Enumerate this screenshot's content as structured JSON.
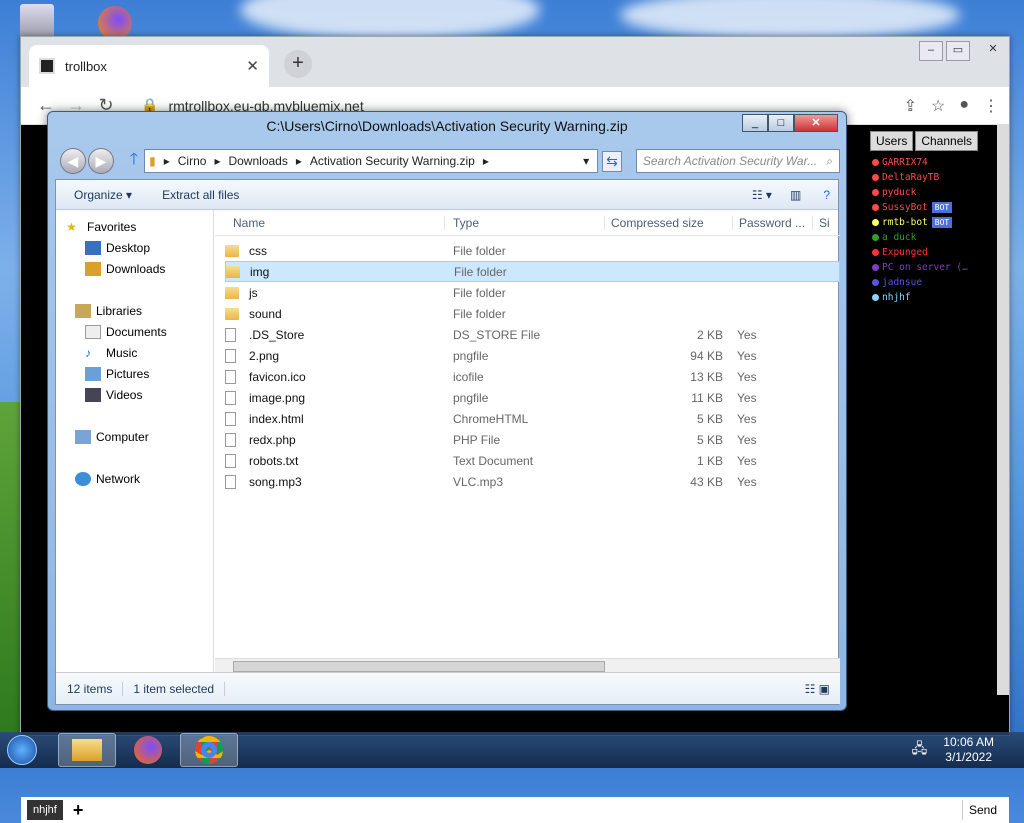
{
  "chrome": {
    "tab_title": "trollbox",
    "url": "rmtrollbox.eu-gb.mybluemix.net",
    "send_label": "Send",
    "input_value": "nhjhf",
    "plus_label": "+"
  },
  "trollbox": {
    "tabs": [
      "Users",
      "Channels"
    ],
    "users": [
      {
        "name": "GARRIX74",
        "color": "#ff4a4a"
      },
      {
        "name": "DeltaRayTB",
        "color": "#ff4a4a"
      },
      {
        "name": "pyduck",
        "color": "#ff4a4a"
      },
      {
        "name": "SussyBot",
        "color": "#ff4a4a",
        "bot": "BOT"
      },
      {
        "name": "rmtb-bot",
        "color": "#ffff66",
        "bot": "BOT"
      },
      {
        "name": "a duck",
        "color": "#2e9f2e"
      },
      {
        "name": "Expunged",
        "color": "#ff3333"
      },
      {
        "name": "PC on server (…",
        "color": "#7c3fbf"
      },
      {
        "name": "jadnsue",
        "color": "#5555dd"
      },
      {
        "name": "nhjhf",
        "color": "#8fd4ff"
      }
    ]
  },
  "explorer": {
    "title": "C:\\Users\\Cirno\\Downloads\\Activation Security Warning.zip",
    "breadcrumb": [
      "Cirno",
      "Downloads",
      "Activation Security Warning.zip"
    ],
    "search_placeholder": "Search Activation Security War...",
    "toolbar": {
      "organize": "Organize ▾",
      "extract": "Extract all files"
    },
    "nav": {
      "favorites": "Favorites",
      "desktop": "Desktop",
      "downloads": "Downloads",
      "libraries": "Libraries",
      "documents": "Documents",
      "music": "Music",
      "pictures": "Pictures",
      "videos": "Videos",
      "computer": "Computer",
      "network": "Network"
    },
    "columns": {
      "name": "Name",
      "type": "Type",
      "compressed": "Compressed size",
      "password": "Password ...",
      "size": "Si"
    },
    "files": [
      {
        "name": "css",
        "type": "File folder",
        "size": "",
        "pw": "",
        "kind": "folder"
      },
      {
        "name": "img",
        "type": "File folder",
        "size": "",
        "pw": "",
        "kind": "folder"
      },
      {
        "name": "js",
        "type": "File folder",
        "size": "",
        "pw": "",
        "kind": "folder"
      },
      {
        "name": "sound",
        "type": "File folder",
        "size": "",
        "pw": "",
        "kind": "folder"
      },
      {
        "name": ".DS_Store",
        "type": "DS_STORE File",
        "size": "2 KB",
        "pw": "Yes",
        "kind": "file"
      },
      {
        "name": "2.png",
        "type": "pngfile",
        "size": "94 KB",
        "pw": "Yes",
        "kind": "file"
      },
      {
        "name": "favicon.ico",
        "type": "icofile",
        "size": "13 KB",
        "pw": "Yes",
        "kind": "file"
      },
      {
        "name": "image.png",
        "type": "pngfile",
        "size": "11 KB",
        "pw": "Yes",
        "kind": "file"
      },
      {
        "name": "index.html",
        "type": "ChromeHTML",
        "size": "5 KB",
        "pw": "Yes",
        "kind": "file"
      },
      {
        "name": "redx.php",
        "type": "PHP File",
        "size": "5 KB",
        "pw": "Yes",
        "kind": "file"
      },
      {
        "name": "robots.txt",
        "type": "Text Document",
        "size": "1 KB",
        "pw": "Yes",
        "kind": "file"
      },
      {
        "name": "song.mp3",
        "type": "VLC.mp3",
        "size": "43 KB",
        "pw": "Yes",
        "kind": "file"
      }
    ],
    "selected_index": 1,
    "status": {
      "count": "12 items",
      "selected": "1 item selected"
    }
  },
  "taskbar": {
    "time": "10:06 AM",
    "date": "3/1/2022"
  }
}
